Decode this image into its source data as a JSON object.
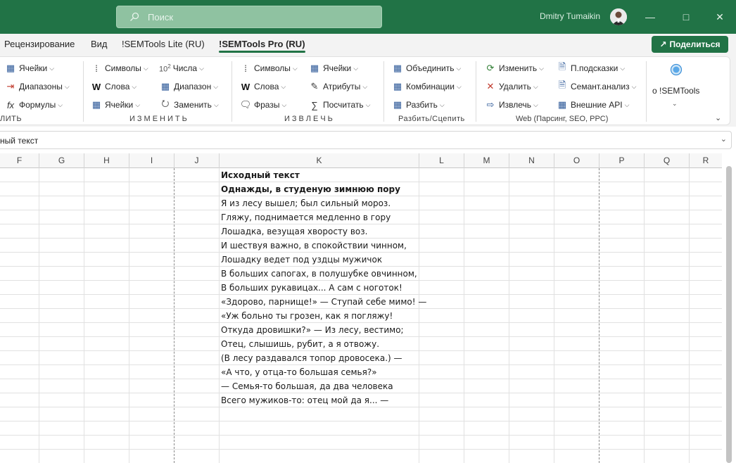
{
  "titlebar": {
    "search_placeholder": "Поиск",
    "user_name": "Dmitry Tumaikin"
  },
  "tabs": [
    {
      "label": "Рецензирование"
    },
    {
      "label": "Вид"
    },
    {
      "label": "!SEMTools Lite (RU)"
    },
    {
      "label": "!SEMTools Pro (RU)",
      "active": true
    }
  ],
  "share_label": "Поделиться",
  "ribbon": {
    "group1": {
      "items": [
        "Ячейки",
        "Диапазоны",
        "Формулы"
      ],
      "label": "ЛИТЬ"
    },
    "group2": {
      "items": [
        "Символы",
        "Числа",
        "Слова",
        "Диапазон",
        "Ячейки",
        "Заменить"
      ],
      "label": "ИЗМЕНИТЬ",
      "sup": "10",
      "sup_exp": "2"
    },
    "group3": {
      "items": [
        "Символы",
        "Ячейки",
        "Слова",
        "Атрибуты",
        "Фразы",
        "Посчитать"
      ],
      "label": "ИЗВЛЕЧЬ"
    },
    "group4": {
      "items": [
        "Объединить",
        "Комбинации",
        "Разбить"
      ],
      "label": "Разбить/Сцепить"
    },
    "group5": {
      "items": [
        "Изменить",
        "П.подсказки",
        "Удалить",
        "Семант.анализ",
        "Извлечь",
        "Внешние API"
      ],
      "label": "Web (Парсинг, SEO, PPC)"
    },
    "group6": {
      "label": "о !SEMTools"
    }
  },
  "formula_bar": {
    "text": "ный текст"
  },
  "columns": [
    "F",
    "G",
    "H",
    "I",
    "J",
    "K",
    "L",
    "M",
    "N",
    "O",
    "P",
    "Q",
    "R"
  ],
  "cells": [
    {
      "text": "Исходный текст",
      "bold": true
    },
    {
      "text": "Однажды, в студеную зимнюю пору",
      "bold": true
    },
    {
      "text": "Я из лесу вышел; был сильный мороз."
    },
    {
      "text": "Гляжу, поднимается медленно в гору"
    },
    {
      "text": "Лошадка, везущая хворосту воз."
    },
    {
      "text": "И шествуя важно, в спокойствии чинном,"
    },
    {
      "text": "Лошадку ведет под уздцы мужичок"
    },
    {
      "text": "В больших сапогах, в полушубке овчинном,"
    },
    {
      "text": "В больших рукавицах... А сам с ноготок!"
    },
    {
      "text": "«Здорово, парнище!» — Ступай себе мимо! —"
    },
    {
      "text": "«Уж больно ты грозен, как я погляжу!"
    },
    {
      "text": "Откуда дровишки?» — Из лесу, вестимо;"
    },
    {
      "text": "Отец, слышишь, рубит, а я отвожу."
    },
    {
      "text": "(В лесу раздавался топор дровосека.) —"
    },
    {
      "text": "«А что, у отца-то большая семья?»"
    },
    {
      "text": "— Семья-то большая, да два человека"
    },
    {
      "text": "Всего мужиков-то: отец мой да я... —"
    }
  ]
}
